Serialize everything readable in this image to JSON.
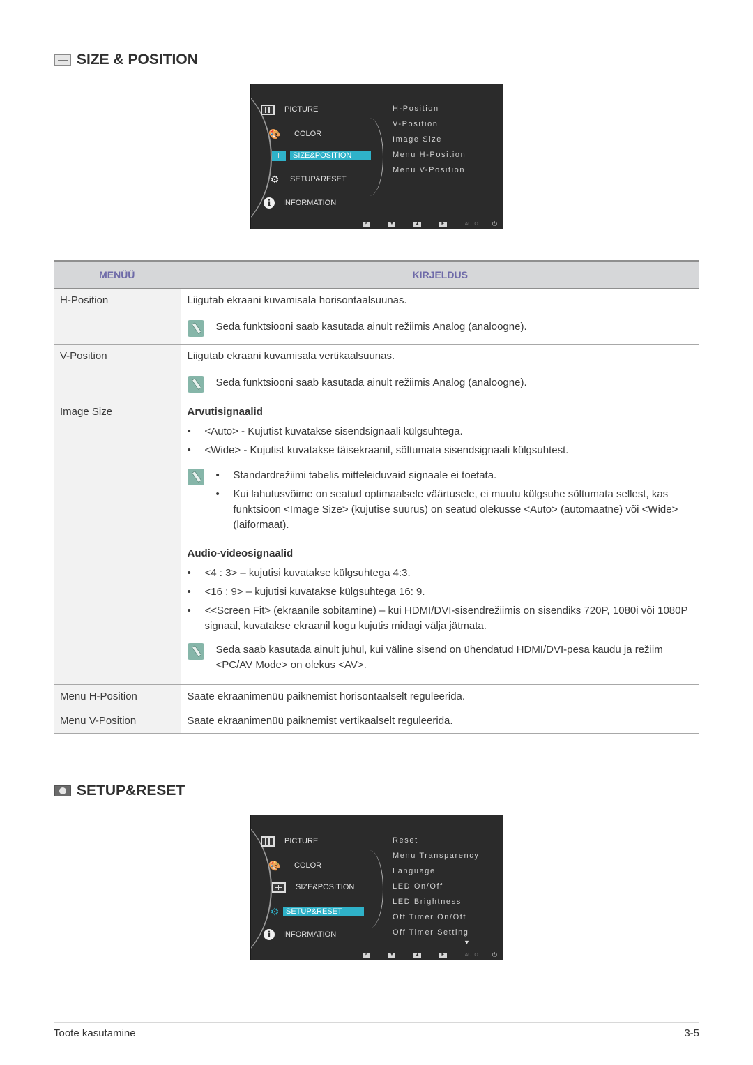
{
  "section1": {
    "title": "SIZE & POSITION",
    "icon": "size-position-icon"
  },
  "osd1": {
    "menu": [
      {
        "label": "PICTURE",
        "icon": "picture-icon"
      },
      {
        "label": "COLOR",
        "icon": "palette-icon"
      },
      {
        "label": "SIZE&POSITION",
        "icon": "size-position-icon",
        "selected": true
      },
      {
        "label": "SETUP&RESET",
        "icon": "gear-icon"
      },
      {
        "label": "INFORMATION",
        "icon": "info-icon"
      }
    ],
    "submenu": [
      "H-Position",
      "V-Position",
      "Image Size",
      "Menu H-Position",
      "Menu V-Position"
    ],
    "buttons": {
      "exit": "✕",
      "down": "▼",
      "up": "▲",
      "enter": "►",
      "auto": "AUTO",
      "power": "⏻"
    }
  },
  "table": {
    "headers": {
      "menu": "MENÜÜ",
      "description": "KIRJELDUS"
    },
    "rows": {
      "hpos": {
        "name": "H-Position",
        "desc": "Liigutab ekraani kuvamisala horisontaalsuunas.",
        "note": "Seda funktsiooni saab kasutada ainult režiimis Analog (analoogne)."
      },
      "vpos": {
        "name": "V-Position",
        "desc": "Liigutab ekraani kuvamisala vertikaalsuunas.",
        "note": "Seda funktsiooni saab kasutada ainult režiimis Analog (analoogne)."
      },
      "imgsize": {
        "name": "Image Size",
        "pc_heading": "Arvutisignaalid",
        "pc_items": [
          "<Auto> - Kujutist kuvatakse sisendsignaali külgsuhtega.",
          "<Wide> - Kujutist kuvatakse täisekraanil, sõltumata sisendsignaali külgsuhtest."
        ],
        "pc_notes": [
          "Standardrežiimi tabelis mitteleiduvaid signaale ei toetata.",
          "Kui lahutusvõime on seatud optimaalsele väärtusele, ei muutu külgsuhe sõltumata sellest, kas funktsioon <Image Size> (kujutise suurus) on seatud olekusse <Auto> (automaatne) või <Wide> (laiformaat)."
        ],
        "av_heading": "Audio-videosignaalid",
        "av_items": [
          "<4 : 3> – kujutisi kuvatakse külgsuhtega 4:3.",
          "<16 : 9> – kujutisi kuvatakse külgsuhtega 16: 9.",
          "<<Screen Fit> (ekraanile sobitamine) – kui HDMI/DVI-sisendrežiimis on sisendiks 720P, 1080i või 1080P signaal, kuvatakse ekraanil kogu kujutis midagi välja jätmata."
        ],
        "av_note": "Seda saab kasutada ainult juhul, kui väline sisend on ühendatud HDMI/DVI-pesa kaudu ja režiim <PC/AV Mode> on olekus <AV>."
      },
      "menuh": {
        "name": "Menu H-Position",
        "desc": "Saate ekraanimenüü paiknemist horisontaalselt reguleerida."
      },
      "menuv": {
        "name": "Menu V-Position",
        "desc": "Saate ekraanimenüü paiknemist vertikaalselt reguleerida."
      }
    }
  },
  "section2": {
    "title": "SETUP&RESET",
    "icon": "gear-icon"
  },
  "osd2": {
    "menu": [
      {
        "label": "PICTURE",
        "icon": "picture-icon"
      },
      {
        "label": "COLOR",
        "icon": "palette-icon"
      },
      {
        "label": "SIZE&POSITION",
        "icon": "size-position-icon"
      },
      {
        "label": "SETUP&RESET",
        "icon": "gear-icon",
        "selected": true
      },
      {
        "label": "INFORMATION",
        "icon": "info-icon"
      }
    ],
    "submenu": [
      "Reset",
      "Menu Transparency",
      "Language",
      "LED On/Off",
      "LED Brightness",
      "Off Timer On/Off",
      "Off Timer Setting"
    ],
    "more_indicator": "▼",
    "buttons": {
      "exit": "✕",
      "down": "▼",
      "up": "▲",
      "enter": "►",
      "auto": "AUTO",
      "power": "⏻"
    }
  },
  "footer": {
    "chapter": "Toote kasutamine",
    "page": "3-5"
  },
  "colors": {
    "osd_highlight": "#2fb2c9",
    "table_header_text": "#6e6aa8",
    "note_icon": "#86b6a9"
  }
}
